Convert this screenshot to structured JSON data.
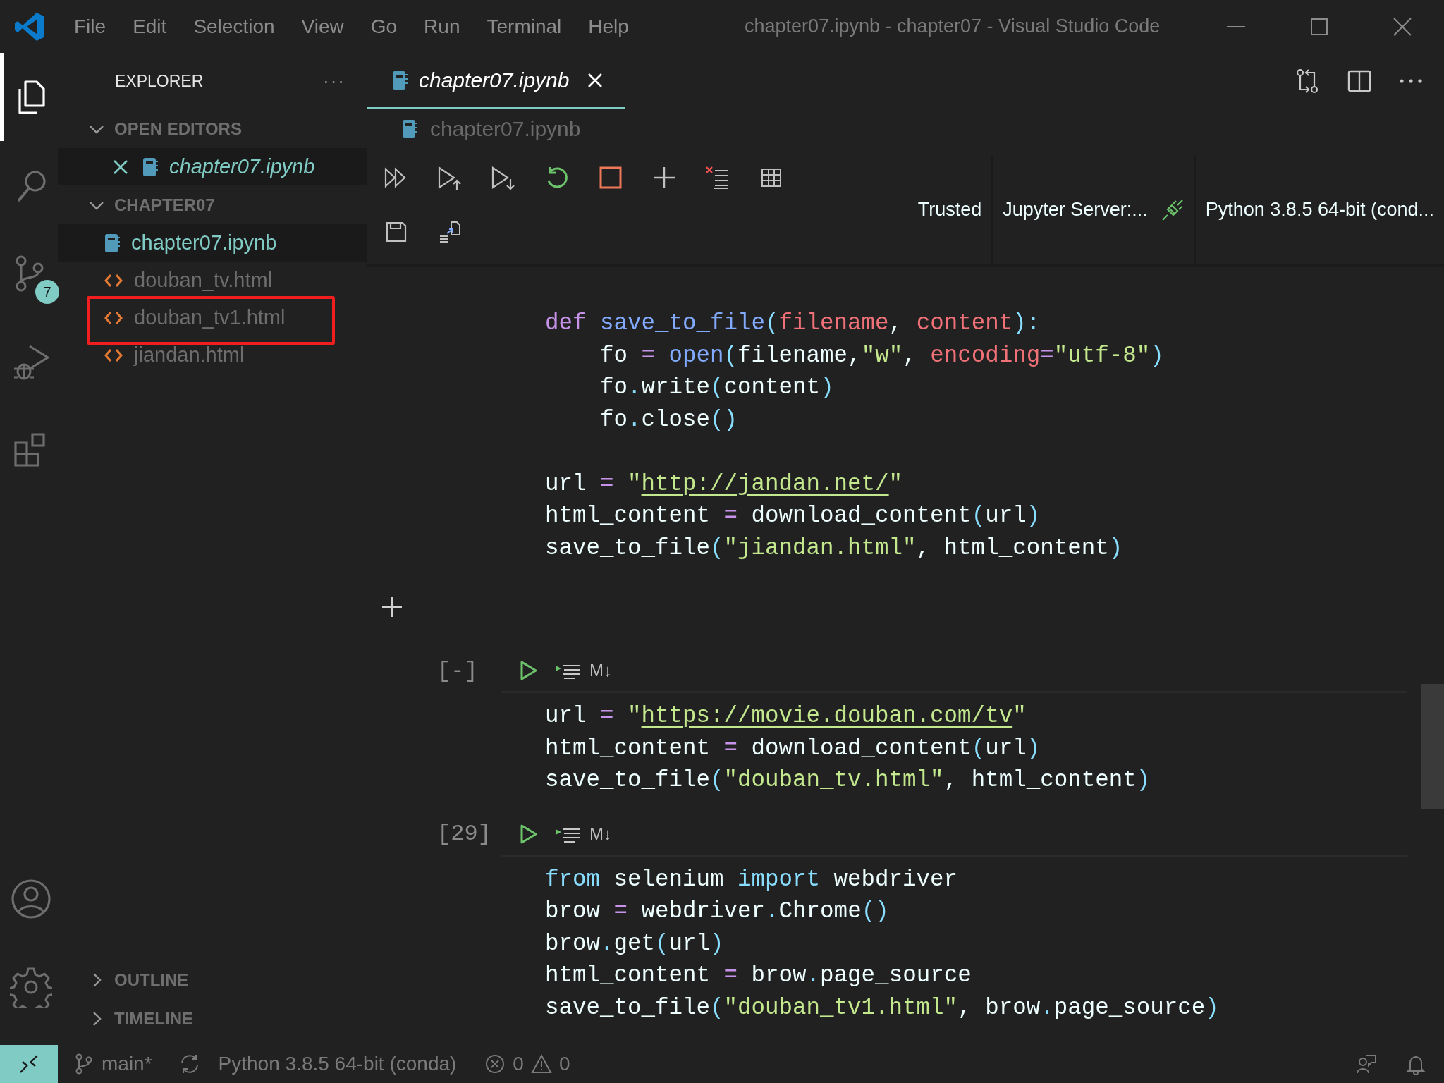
{
  "title_bar": {
    "menu": [
      "File",
      "Edit",
      "Selection",
      "View",
      "Go",
      "Run",
      "Terminal",
      "Help"
    ],
    "title": "chapter07.ipynb - chapter07 - Visual Studio Code"
  },
  "activity_bar": {
    "items": [
      {
        "kind": "explorer",
        "selected": true
      },
      {
        "kind": "search",
        "selected": false
      },
      {
        "kind": "source-control",
        "selected": false,
        "badge": "7"
      },
      {
        "kind": "run-debug",
        "selected": false
      },
      {
        "kind": "extensions",
        "selected": false
      }
    ],
    "bottom": [
      {
        "kind": "accounts",
        "selected": false
      },
      {
        "kind": "settings",
        "selected": false
      }
    ]
  },
  "sidebar": {
    "title": "EXPLORER",
    "more": "···",
    "sections": [
      {
        "label": "OPEN EDITORS",
        "expanded": true,
        "items": [
          {
            "name": "chapter07.ipynb",
            "kind": "notebook",
            "selected": true,
            "preview": true,
            "closable": true
          }
        ]
      },
      {
        "label": "CHAPTER07",
        "expanded": true,
        "items": [
          {
            "name": "chapter07.ipynb",
            "kind": "notebook",
            "selected": true,
            "preview": false,
            "highlighted": false
          },
          {
            "name": "douban_tv.html",
            "kind": "html",
            "selected": false,
            "preview": false,
            "highlighted": false
          },
          {
            "name": "douban_tv1.html",
            "kind": "html",
            "selected": false,
            "preview": false,
            "highlighted": true
          },
          {
            "name": "jiandan.html",
            "kind": "html",
            "selected": false,
            "preview": false,
            "highlighted": false
          }
        ]
      },
      {
        "label": "OUTLINE",
        "expanded": false
      },
      {
        "label": "TIMELINE",
        "expanded": false
      }
    ]
  },
  "editor": {
    "tabs": [
      {
        "label": "chapter07.ipynb",
        "selected": true,
        "preview": true
      }
    ],
    "breadcrumb": "chapter07.ipynb",
    "toolbar": {
      "trusted": "Trusted",
      "server": "Jupyter Server:...",
      "kernel": "Python 3.8.5 64-bit (cond..."
    },
    "cells": [
      {
        "blocks": [
          [
            [
              {
                "kind": "kw",
                "text": "def"
              },
              {
                "kind": "fn",
                "text": " save_to_file"
              },
              {
                "kind": "pu",
                "text": "("
              },
              {
                "kind": "pa",
                "text": "filename"
              },
              {
                "kind": "pl",
                "text": ", "
              },
              {
                "kind": "pa",
                "text": "content"
              },
              {
                "kind": "pu",
                "text": "):"
              }
            ],
            [
              {
                "kind": "pl",
                "text": "    fo "
              },
              {
                "kind": "op",
                "text": "="
              },
              {
                "kind": "fn",
                "text": " open"
              },
              {
                "kind": "pu",
                "text": "("
              },
              {
                "kind": "pl",
                "text": "filename,"
              },
              {
                "kind": "st",
                "text": "\"w\""
              },
              {
                "kind": "pl",
                "text": ", "
              },
              {
                "kind": "pa",
                "text": "encoding"
              },
              {
                "kind": "op",
                "text": "="
              },
              {
                "kind": "st",
                "text": "\"utf-8\""
              },
              {
                "kind": "pu",
                "text": ")"
              }
            ],
            [
              {
                "kind": "pl",
                "text": "    fo"
              },
              {
                "kind": "pu",
                "text": "."
              },
              {
                "kind": "pl",
                "text": "write"
              },
              {
                "kind": "pu",
                "text": "("
              },
              {
                "kind": "pl",
                "text": "content"
              },
              {
                "kind": "pu",
                "text": ")"
              }
            ],
            [
              {
                "kind": "pl",
                "text": "    fo"
              },
              {
                "kind": "pu",
                "text": "."
              },
              {
                "kind": "pl",
                "text": "close"
              },
              {
                "kind": "pu",
                "text": "()"
              }
            ]
          ],
          [
            [
              {
                "kind": "pl",
                "text": "url "
              },
              {
                "kind": "op",
                "text": "="
              },
              {
                "kind": "st",
                "text": " \""
              },
              {
                "kind": "ln",
                "text": "http://jandan.net/"
              },
              {
                "kind": "st",
                "text": "\""
              }
            ],
            [
              {
                "kind": "pl",
                "text": "html_content "
              },
              {
                "kind": "op",
                "text": "="
              },
              {
                "kind": "pl",
                "text": " download_content"
              },
              {
                "kind": "pu",
                "text": "("
              },
              {
                "kind": "pl",
                "text": "url"
              },
              {
                "kind": "pu",
                "text": ")"
              }
            ],
            [
              {
                "kind": "pl",
                "text": "save_to_file"
              },
              {
                "kind": "pu",
                "text": "("
              },
              {
                "kind": "st",
                "text": "\"jiandan.html\""
              },
              {
                "kind": "pl",
                "text": ", html_content"
              },
              {
                "kind": "pu",
                "text": ")"
              }
            ]
          ]
        ]
      },
      {
        "count": "[-]",
        "markdown": "M↓",
        "blocks": [
          [
            [
              {
                "kind": "pl",
                "text": "url "
              },
              {
                "kind": "op",
                "text": "="
              },
              {
                "kind": "st",
                "text": " \""
              },
              {
                "kind": "ln",
                "text": "https://movie.douban.com/tv"
              },
              {
                "kind": "st",
                "text": "\""
              }
            ],
            [
              {
                "kind": "pl",
                "text": "html_content "
              },
              {
                "kind": "op",
                "text": "="
              },
              {
                "kind": "pl",
                "text": " download_content"
              },
              {
                "kind": "pu",
                "text": "("
              },
              {
                "kind": "pl",
                "text": "url"
              },
              {
                "kind": "pu",
                "text": ")"
              }
            ],
            [
              {
                "kind": "pl",
                "text": "save_to_file"
              },
              {
                "kind": "pu",
                "text": "("
              },
              {
                "kind": "st",
                "text": "\"douban_tv.html\""
              },
              {
                "kind": "pl",
                "text": ", html_content"
              },
              {
                "kind": "pu",
                "text": ")"
              }
            ]
          ]
        ]
      },
      {
        "count": "[29]",
        "markdown": "M↓",
        "blocks": [
          [
            [
              {
                "kind": "k2",
                "text": "from"
              },
              {
                "kind": "pl",
                "text": " selenium "
              },
              {
                "kind": "k2",
                "text": "import"
              },
              {
                "kind": "pl",
                "text": " webdriver"
              }
            ],
            [
              {
                "kind": "pl",
                "text": "brow "
              },
              {
                "kind": "op",
                "text": "="
              },
              {
                "kind": "pl",
                "text": " webdriver"
              },
              {
                "kind": "pu",
                "text": "."
              },
              {
                "kind": "pl",
                "text": "Chrome"
              },
              {
                "kind": "pu",
                "text": "()"
              }
            ],
            [
              {
                "kind": "pl",
                "text": "brow"
              },
              {
                "kind": "pu",
                "text": "."
              },
              {
                "kind": "pl",
                "text": "get"
              },
              {
                "kind": "pu",
                "text": "("
              },
              {
                "kind": "pl",
                "text": "url"
              },
              {
                "kind": "pu",
                "text": ")"
              }
            ],
            [
              {
                "kind": "pl",
                "text": "html_content "
              },
              {
                "kind": "op",
                "text": "="
              },
              {
                "kind": "pl",
                "text": " brow"
              },
              {
                "kind": "pu",
                "text": "."
              },
              {
                "kind": "pl",
                "text": "page_source"
              }
            ],
            [
              {
                "kind": "pl",
                "text": "save_to_file"
              },
              {
                "kind": "pu",
                "text": "("
              },
              {
                "kind": "st",
                "text": "\"douban_tv1.html\""
              },
              {
                "kind": "pl",
                "text": ", brow"
              },
              {
                "kind": "pu",
                "text": "."
              },
              {
                "kind": "pl",
                "text": "page_source"
              },
              {
                "kind": "pu",
                "text": ")"
              }
            ]
          ]
        ]
      }
    ]
  },
  "status_bar": {
    "branch": "main*",
    "interpreter": "Python 3.8.5 64-bit (conda)",
    "errors": "0",
    "warnings": "0"
  }
}
